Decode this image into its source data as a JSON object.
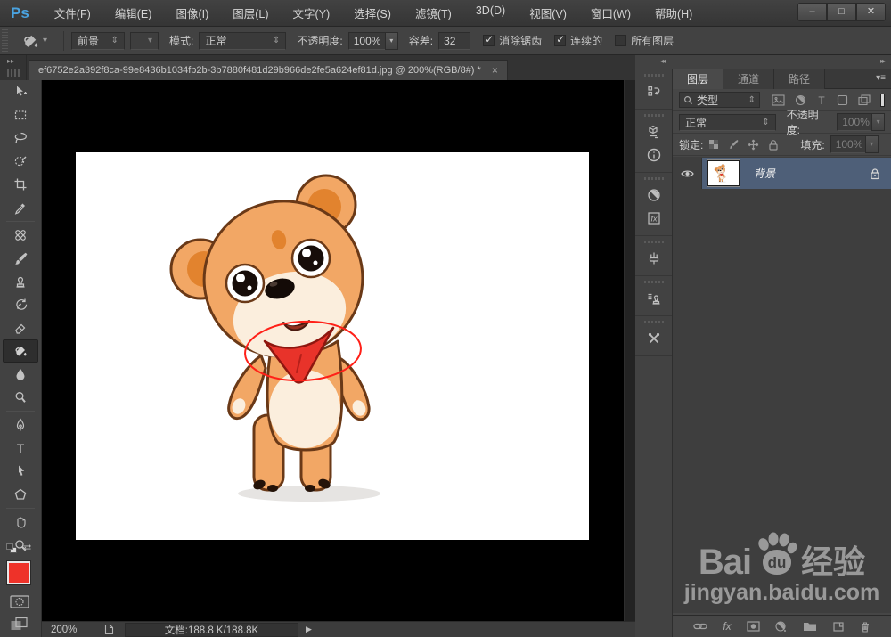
{
  "titlebar": {
    "logo": "Ps",
    "menus": [
      "文件(F)",
      "编辑(E)",
      "图像(I)",
      "图层(L)",
      "文字(Y)",
      "选择(S)",
      "滤镜(T)",
      "3D(D)",
      "视图(V)",
      "窗口(W)",
      "帮助(H)"
    ]
  },
  "options_bar": {
    "active_tool": "paint-bucket-tool",
    "fill_source_value": "前景",
    "mode_label": "模式:",
    "mode_value": "正常",
    "opacity_label": "不透明度:",
    "opacity_value": "100%",
    "tolerance_label": "容差:",
    "tolerance_value": "32",
    "anti_alias_label": "消除锯齿",
    "anti_alias_checked": true,
    "contiguous_label": "连续的",
    "contiguous_checked": true,
    "all_layers_label": "所有图层",
    "all_layers_checked": false
  },
  "document_tab": {
    "title": "ef6752e2a392f8ca-99e8436b1034fb2b-3b7880f481d29b966de2fe5a624ef81d.jpg @ 200%(RGB/8#) *"
  },
  "toolbar": {
    "tools": [
      "move-tool",
      "rectangular-marquee-tool",
      "lasso-tool",
      "quick-selection-tool",
      "crop-tool",
      "eyedropper-tool",
      "spot-healing-brush-tool",
      "brush-tool",
      "clone-stamp-tool",
      "history-brush-tool",
      "eraser-tool",
      "paint-bucket-tool",
      "blur-tool",
      "dodge-tool",
      "pen-tool",
      "type-tool",
      "path-selection-tool",
      "shape-tool",
      "hand-tool",
      "zoom-tool"
    ],
    "selected_tool": "paint-bucket-tool",
    "foreground_color": "#ee3229",
    "background_color": "#ffffff"
  },
  "canvas": {
    "description": "cartoon teddy bear with red neckerchief on white background, red ellipse annotation around the neck",
    "annotation_color": "#ff2018"
  },
  "side_strip": {
    "panels": [
      "history",
      "properties",
      "info",
      "adjustments",
      "styles",
      "brush",
      "clone-source",
      "tool-presets"
    ]
  },
  "layers_panel": {
    "tabs": [
      "图层",
      "通道",
      "路径"
    ],
    "filter_kind_value": "类型",
    "blend_mode_value": "正常",
    "opacity_label": "不透明度:",
    "opacity_value": "100%",
    "lock_label": "锁定:",
    "fill_label": "填充:",
    "fill_value": "100%",
    "layers": [
      {
        "name": "背景",
        "visible": true,
        "locked": true,
        "selected": true
      }
    ]
  },
  "status_bar": {
    "zoom_value": "200%",
    "document_info": "文档:188.8 K/188.8K"
  },
  "watermark": {
    "part1": "Bai",
    "part2": "du",
    "part3": "经验",
    "url": "jingyan.baidu.com"
  },
  "icons": {
    "minimize": "–",
    "maximize": "□",
    "close": "✕",
    "tab_close": "×",
    "spinner": "⇕",
    "dropdown": "▾",
    "collapse_left": "◂◂",
    "collapse_right": "▸▸",
    "panel_menu": "▾≡",
    "status_play": "▶",
    "swap_colors": "⇄",
    "type_tool_glyph": "T",
    "fx": "fx",
    "type_filter_glyph": "T"
  },
  "colors": {
    "ui_background": "#424242",
    "canvas_background": "#000000",
    "selected_layer_row": "#4e5f78",
    "foreground_swatch": "#ee3229",
    "logo_blue": "#4aa3e0",
    "bandana_red": "#e8332a"
  }
}
